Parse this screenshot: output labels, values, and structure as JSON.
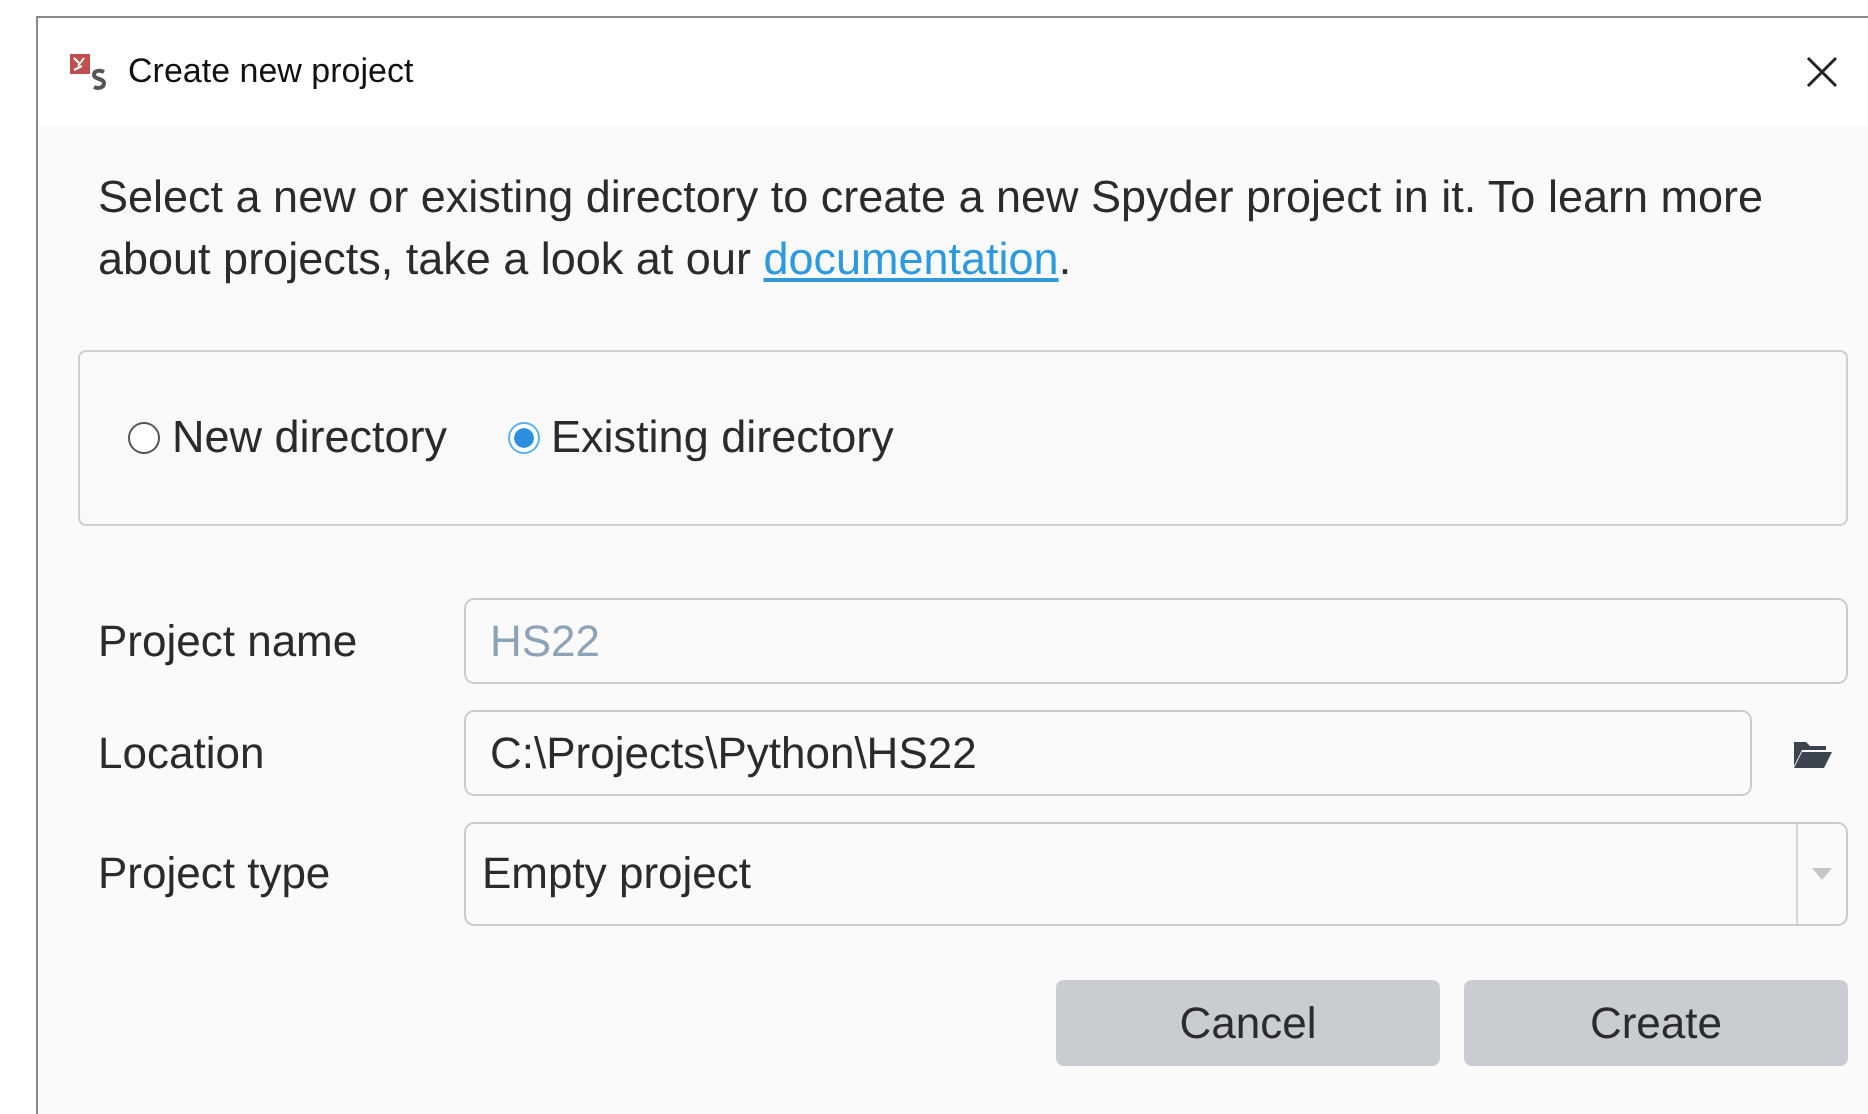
{
  "window": {
    "title": "Create new project"
  },
  "description": {
    "text": "Select a new or existing directory to create a new Spyder project in it. To learn more about projects, take a look at our",
    "link": "documentation",
    "after": "."
  },
  "directory_options": [
    {
      "label": "New directory",
      "selected": false
    },
    {
      "label": "Existing directory",
      "selected": true
    }
  ],
  "form": [
    {
      "kind": "text",
      "label": "Project name",
      "value": "HS22",
      "disabled": true
    },
    {
      "kind": "path",
      "label": "Location",
      "value": "C:\\Projects\\Python\\HS22",
      "disabled": false
    },
    {
      "kind": "combo",
      "label": "Project type",
      "value": "Empty project",
      "disabled": false
    }
  ],
  "buttons": [
    "Cancel",
    "Create"
  ]
}
